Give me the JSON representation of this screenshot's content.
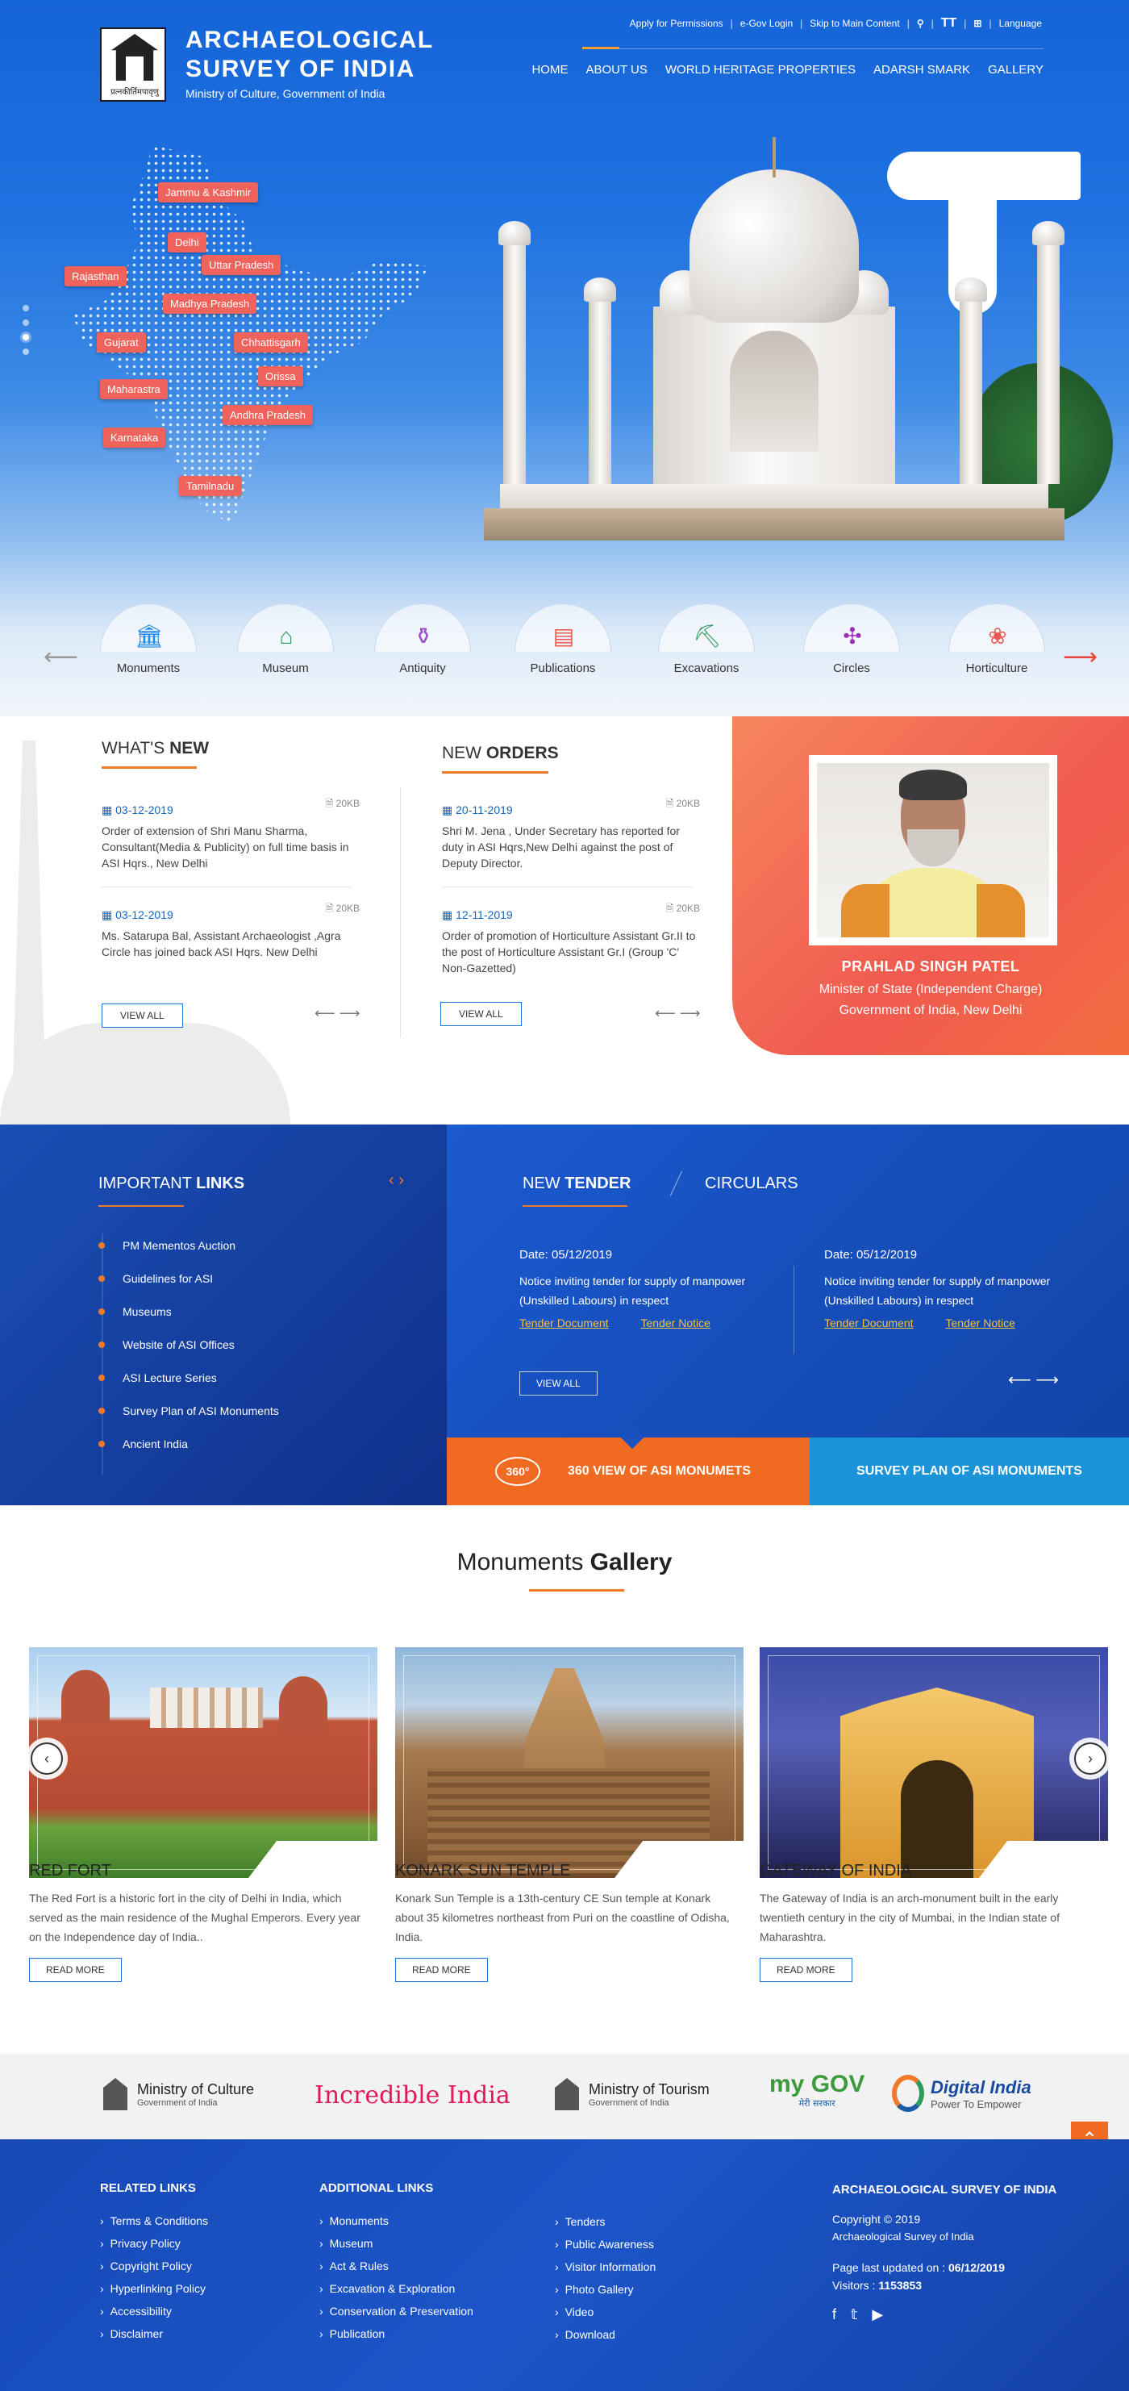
{
  "header": {
    "title_line1": "ARCHAEOLOGICAL",
    "title_line2": "SURVEY OF INDIA",
    "subtitle": "Ministry of Culture, Government of India",
    "logo_text": "प्रत्नकीर्तिमपावृणु",
    "util_links": [
      "Apply for Permissions",
      "e-Gov Login",
      "Skip to Main Content",
      "Language"
    ],
    "text_size_label": "TT",
    "nav": [
      "HOME",
      "ABOUT US",
      "WORLD HERITAGE PROPERTIES",
      "ADARSH SMARK",
      "GALLERY"
    ]
  },
  "map_states": [
    "Jammu & Kashmir",
    "Delhi",
    "Rajasthan",
    "Uttar Pradesh",
    "Madhya Pradesh",
    "Gujarat",
    "Chhattisgarh",
    "Orissa",
    "Maharastra",
    "Andhra Pradesh",
    "Karnataka",
    "Tamilnadu"
  ],
  "categories": [
    "Monuments",
    "Museum",
    "Antiquity",
    "Publications",
    "Excavations",
    "Circles",
    "Horticulture"
  ],
  "whats_new": {
    "title_light": "WHAT'S ",
    "title_bold": "NEW",
    "items": [
      {
        "date": "03-12-2019",
        "size": "20KB",
        "text": "Order of extension of Shri Manu Sharma, Consultant(Media & Publicity) on full time basis in ASI Hqrs., New Delhi"
      },
      {
        "date": "03-12-2019",
        "size": "20KB",
        "text": "Ms. Satarupa Bal, Assistant Archaeologist ,Agra Circle has joined back ASI Hqrs. New Delhi"
      }
    ],
    "button": "VIEW ALL"
  },
  "new_orders": {
    "title_light": "NEW ",
    "title_bold": "ORDERS",
    "items": [
      {
        "date": "20-11-2019",
        "size": "20KB",
        "text": "Shri M. Jena , Under Secretary has reported for duty in ASI Hqrs,New Delhi against the post of Deputy Director."
      },
      {
        "date": "12-11-2019",
        "size": "20KB",
        "text": "Order of promotion of Horticulture Assistant Gr.II to the post of Horticulture Assistant Gr.I (Group 'C' Non-Gazetted)"
      }
    ],
    "button": "VIEW ALL"
  },
  "minister": {
    "name": "PRAHLAD SINGH PATEL",
    "role1": "Minister of State (Independent Charge)",
    "role2": "Government of India, New Delhi"
  },
  "important_links": {
    "title_light": "IMPORTANT ",
    "title_bold": "LINKS",
    "items": [
      "PM Mementos Auction",
      "Guidelines for ASI",
      "Museums",
      "Website of ASI Offices",
      "ASI Lecture Series",
      "Survey Plan of ASI Monuments",
      "Ancient India"
    ]
  },
  "tenders": {
    "tab1_light": "NEW ",
    "tab1_bold": "TENDER",
    "tab2": "CIRCULARS",
    "items": [
      {
        "date": "Date: 05/12/2019",
        "text": "Notice inviting tender for supply of manpower (Unskilled Labours) in respect",
        "doc": "Tender Document",
        "notice": "Tender Notice"
      },
      {
        "date": "Date: 05/12/2019",
        "text": "Notice inviting tender for supply of manpower (Unskilled Labours) in respect",
        "doc": "Tender Document",
        "notice": "Tender Notice"
      }
    ],
    "button": "VIEW ALL"
  },
  "banners": {
    "view360_icon": "360°",
    "view360": "360 VIEW OF ASI MONUMETS",
    "survey": "SURVEY PLAN OF ASI MONUMENTS"
  },
  "gallery": {
    "title_light": "Monuments ",
    "title_bold": "Gallery",
    "cards": [
      {
        "name": "RED FORT",
        "desc": "The Red Fort is a historic fort in the city of Delhi in India, which served as the main residence of the Mughal Emperors. Every year on the Independence day of India..",
        "button": "READ MORE"
      },
      {
        "name": "KONARK SUN TEMPLE",
        "desc": "Konark Sun Temple is a 13th-century CE Sun temple at Konark about 35 kilometres northeast from Puri on the coastline of Odisha, India.",
        "button": "READ MORE"
      },
      {
        "name": "GATEWAY OF INDIA",
        "desc": "The Gateway of India is an arch-monument built in the early twentieth century in the city of Mumbai, in the Indian state of Maharashtra.",
        "button": "READ MORE"
      }
    ]
  },
  "partners": {
    "culture": "Ministry of Culture",
    "culture_sub": "Government of India",
    "incredible": "Incredible India",
    "tourism": "Ministry of Tourism",
    "tourism_sub": "Government of India",
    "mygov": "my GOV",
    "mygov_sub": "मेरी सरकार",
    "digital": "Digital India",
    "digital_sub": "Power To Empower"
  },
  "footer": {
    "related_title": "RELATED LINKS",
    "related": [
      "Terms & Conditions",
      "Privacy Policy",
      "Copyright Policy",
      "Hyperlinking Policy",
      "Accessibility",
      "Disclaimer"
    ],
    "additional_title": "ADDITIONAL LINKS",
    "additional": [
      "Monuments",
      "Museum",
      "Act & Rules",
      "Excavation & Exploration",
      "Conservation & Preservation",
      "Publication"
    ],
    "more": [
      "Tenders",
      "Public Awareness",
      "Visitor Information",
      "Photo Gallery",
      "Video",
      "Download"
    ],
    "org": "ARCHAEOLOGICAL SURVEY OF INDIA",
    "copyright": "Copyright © 2019",
    "copyright2": "Archaeological Survey of India",
    "updated_label": "Page last updated on : ",
    "updated": "06/12/2019",
    "visitors_label": "Visitors : ",
    "visitors": "1153853"
  },
  "colors": {
    "brand_blue": "#1f6fdd",
    "accent_orange": "#f07a2a",
    "state_pill": "#f0625c",
    "tender_link": "#f5c342"
  }
}
